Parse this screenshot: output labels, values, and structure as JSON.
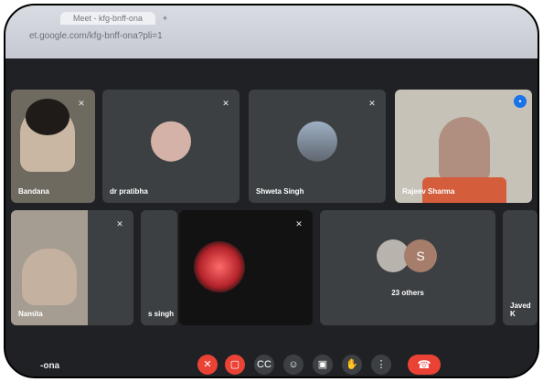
{
  "browser": {
    "tab_text": "Meet - kfg-bnff-ona",
    "url": "et.google.com/kfg-bnff-ona?pli=1"
  },
  "participants": [
    {
      "name": "Bandana",
      "icon": "mic-off-icon"
    },
    {
      "name": "dr pratibha",
      "icon": "mic-off-icon"
    },
    {
      "name": "Shweta Singh",
      "icon": "mic-off-icon"
    },
    {
      "name": "Rajeev Sharma",
      "icon": "speaking-icon"
    },
    {
      "name": "Namita",
      "icon": "mic-off-icon"
    },
    {
      "name": "s singh",
      "icon": "mic-off-icon"
    },
    {
      "name": "",
      "icon": "mic-off-icon"
    },
    {
      "name": "23 others",
      "badge": "S"
    },
    {
      "name": "Javed K",
      "icon": "mic-off-icon"
    }
  ],
  "footer": {
    "meeting_code": "-ona"
  },
  "controls": {
    "mic": "mic-off-icon",
    "camera": "camera-off-icon",
    "captions": "captions-icon",
    "reactions": "emoji-icon",
    "present": "present-icon",
    "raise_hand": "hand-icon",
    "more": "more-icon",
    "end": "end-call-icon"
  },
  "colors": {
    "background": "#202124",
    "tile": "#3c4043",
    "accent": "#1a73e8",
    "danger": "#ea4335"
  }
}
